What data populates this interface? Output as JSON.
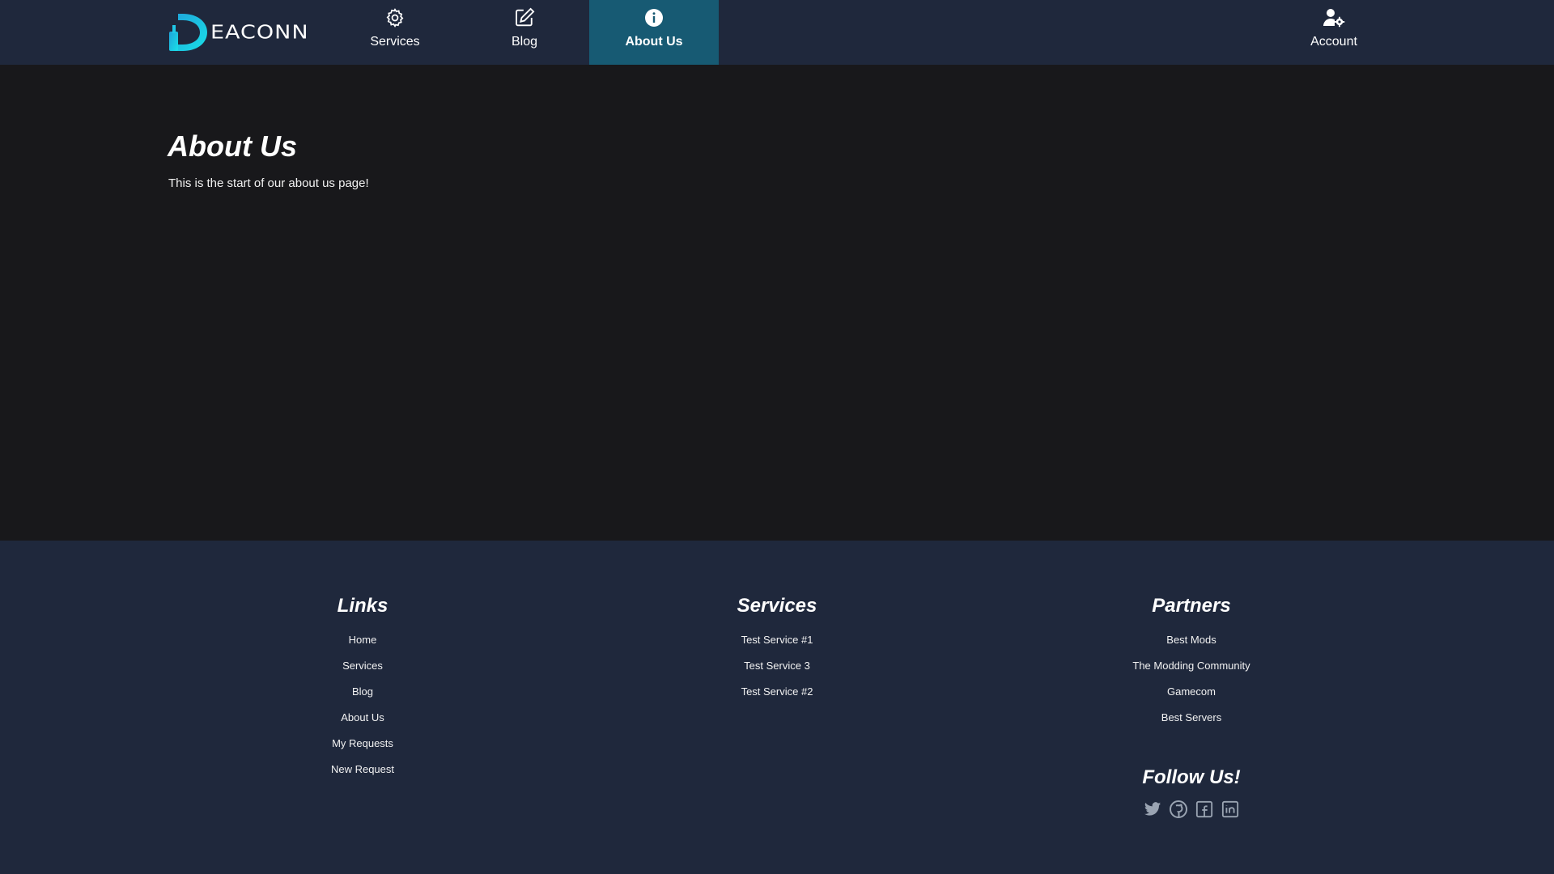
{
  "brand": {
    "name": "EACONN",
    "logo_letter": "D",
    "accent": "#1ec8e6"
  },
  "nav": {
    "services": {
      "label": "Services",
      "icon": "gear-icon"
    },
    "blog": {
      "label": "Blog",
      "icon": "edit-icon"
    },
    "about": {
      "label": "About Us",
      "icon": "info-icon",
      "active": true
    },
    "account": {
      "label": "Account",
      "icon": "user-settings-icon"
    }
  },
  "main": {
    "title": "About Us",
    "intro": "This is the start of our about us page!"
  },
  "footer": {
    "links": {
      "heading": "Links",
      "items": [
        "Home",
        "Services",
        "Blog",
        "About Us",
        "My Requests",
        "New Request"
      ]
    },
    "services": {
      "heading": "Services",
      "items": [
        "Test Service #1",
        "Test Service 3",
        "Test Service #2"
      ]
    },
    "partners": {
      "heading": "Partners",
      "items": [
        "Best Mods",
        "The Modding Community",
        "Gamecom",
        "Best Servers"
      ]
    },
    "follow": {
      "heading": "Follow Us!",
      "icons": [
        "twitter-icon",
        "github-icon",
        "facebook-icon",
        "linkedin-icon"
      ]
    }
  },
  "colors": {
    "header_bg": "#1f283c",
    "page_bg": "#18181b",
    "active_tab": "#175a73",
    "footer_bg": "#1f283c"
  }
}
